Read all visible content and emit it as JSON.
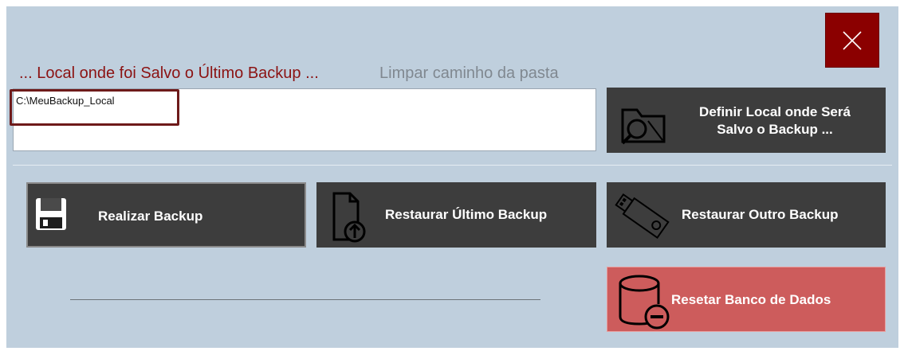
{
  "window": {
    "background": "#bfcfdd",
    "close_icon": "close-icon"
  },
  "path_section": {
    "title": "... Local onde foi Salvo o Último Backup ...",
    "clear_link": "Limpar caminho da pasta",
    "path_value": "C:\\MeuBackup_Local"
  },
  "buttons": {
    "define_location": {
      "line1": "Definir Local onde Será",
      "line2": "Salvo o  Backup ...",
      "icon": "folder-search-icon"
    },
    "backup": {
      "label": "Realizar Backup",
      "icon": "floppy-disk-icon"
    },
    "restore_last": {
      "label": "Restaurar Último Backup",
      "icon": "file-upload-icon"
    },
    "restore_other": {
      "label": "Restaurar Outro Backup",
      "icon": "usb-drive-icon"
    },
    "reset_db": {
      "label": "Resetar Banco de Dados",
      "icon": "database-remove-icon",
      "color": "#cd5c5c"
    }
  }
}
